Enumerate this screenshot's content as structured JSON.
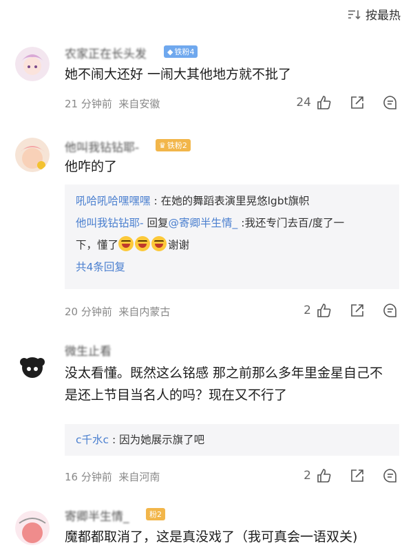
{
  "sort": {
    "label": "按最热",
    "icon": "sort-icon"
  },
  "comments": [
    {
      "username": "农家正在长头发",
      "badge": "铁粉4",
      "text": "她不闹大还好 一闹大其他地方就不批了",
      "time": "21 分钟前",
      "location": "来自安徽",
      "likes": "24"
    },
    {
      "username": "他叫我钻钻耶-",
      "badge": "铁粉2",
      "text": "他咋的了",
      "replies": [
        {
          "user": "吼哈吼哈嘿嘿嘿",
          "sep": " : ",
          "content": "在她的舞蹈表演里晃悠lgbt旗帜"
        },
        {
          "user": "他叫我钻钻耶-",
          "reply_word": " 回复",
          "mention": "@寄卿半生情_",
          "content_a": " :我还专门去百/度了一",
          "content_b": "下，懂了",
          "emoji_count": 3,
          "content_c": "谢谢"
        }
      ],
      "more_replies": "共4条回复",
      "time": "20 分钟前",
      "location": "来自内蒙古",
      "likes": "2"
    },
    {
      "username": "微生止看",
      "text_line1": "没太看懂。既然这么铭感 那之前那么多年里金星自己不",
      "text_line2": "是还上节目当名人的吗？现在又不行了",
      "replies": [
        {
          "user": "c千水c",
          "sep": " : ",
          "content": "因为她展示旗了吧"
        }
      ],
      "time": "16 分钟前",
      "location": "来自河南",
      "likes": "2"
    },
    {
      "username": "寄卿半生情_",
      "badge": "粉2",
      "text": "魔都都取消了，这是真没戏了（我可真会一语双关)"
    }
  ]
}
